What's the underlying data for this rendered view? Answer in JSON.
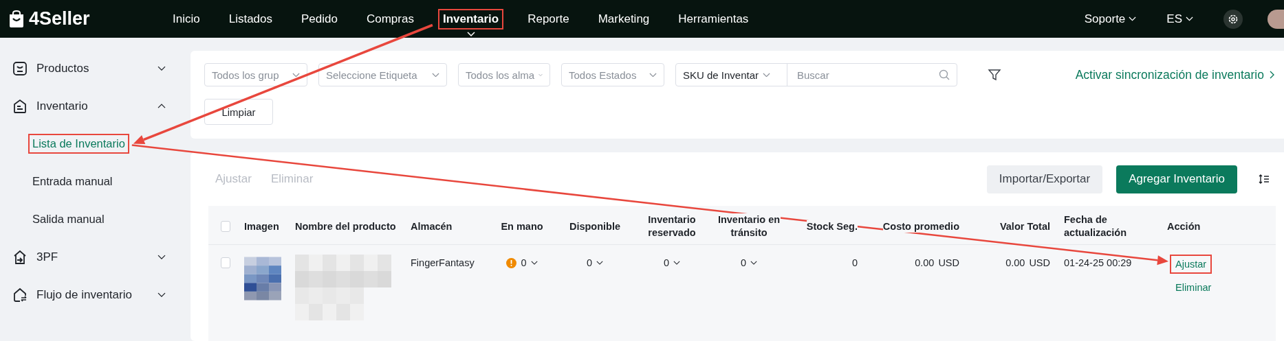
{
  "app": {
    "logo": "4Seller"
  },
  "nav": [
    {
      "label": "Inicio",
      "selected": false,
      "highlighted": false
    },
    {
      "label": "Listados",
      "selected": false,
      "highlighted": false
    },
    {
      "label": "Pedido",
      "selected": false,
      "highlighted": false
    },
    {
      "label": "Compras",
      "selected": false,
      "highlighted": false
    },
    {
      "label": "Inventario",
      "selected": true,
      "highlighted": true
    },
    {
      "label": "Reporte",
      "selected": false,
      "highlighted": false
    },
    {
      "label": "Marketing",
      "selected": false,
      "highlighted": false
    },
    {
      "label": "Herramientas",
      "selected": false,
      "highlighted": false
    }
  ],
  "top_right": [
    {
      "label": "Soporte"
    },
    {
      "label": "ES"
    }
  ],
  "sidebar": [
    {
      "label": "Productos",
      "expanded": false
    },
    {
      "label": "Inventario",
      "expanded": true,
      "children": [
        {
          "label": "Lista de Inventario",
          "selected": true,
          "highlighted": true
        },
        {
          "label": "Entrada manual",
          "selected": false,
          "highlighted": false
        },
        {
          "label": "Salida manual",
          "selected": false,
          "highlighted": false
        }
      ]
    },
    {
      "label": "3PF",
      "expanded": false
    },
    {
      "label": "Flujo de inventario",
      "expanded": false
    }
  ],
  "filters": {
    "selects": [
      {
        "placeholder": "Todos los grup"
      },
      {
        "placeholder": "Seleccione Etiqueta"
      },
      {
        "placeholder": "Todos los alma"
      },
      {
        "placeholder": "Todos Estados"
      }
    ],
    "search": {
      "scope": "SKU de Inventar",
      "placeholder": "Buscar"
    },
    "sync_link": "Activar sincronización de inventario",
    "clear_button": "Limpiar"
  },
  "toolbar": {
    "bulk_actions": [
      {
        "label": "Ajustar",
        "disabled": true
      },
      {
        "label": "Eliminar",
        "disabled": true
      }
    ],
    "buttons": [
      {
        "label": "Importar/Exportar",
        "kind": "secondary"
      },
      {
        "label": "Agregar Inventario",
        "kind": "primary"
      }
    ]
  },
  "table": {
    "all_checked": false,
    "columns": [
      "Imagen",
      "Nombre del producto",
      "Almacén",
      "En mano",
      "Disponible",
      "Inventario reservado",
      "Inventario en tránsito",
      "Stock Seg.",
      "Costo promedio",
      "Valor Total",
      "Fecha de actualización",
      "Acción"
    ],
    "rows": [
      {
        "checked": false,
        "warehouse": "FingerFantasy",
        "on_hand": "0",
        "on_hand_warning": true,
        "available": "0",
        "reserved": "0",
        "in_transit": "0",
        "safety_stock": "0",
        "avg_cost": "0.00",
        "avg_cost_currency": "USD",
        "total_value": "0.00",
        "total_value_currency": "USD",
        "updated": "01-24-25 00:29",
        "actions": [
          {
            "label": "Ajustar",
            "highlighted": true
          },
          {
            "label": "Eliminar",
            "highlighted": false
          }
        ]
      }
    ]
  }
}
